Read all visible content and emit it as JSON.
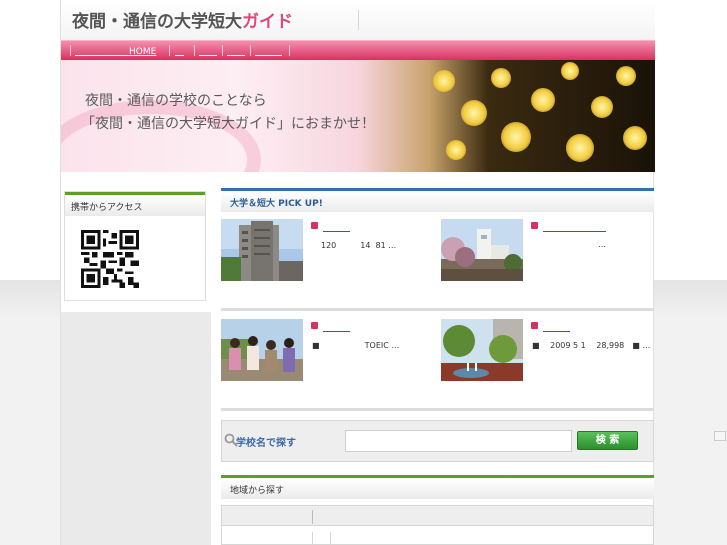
{
  "header": {
    "logo_main": "夜間・通信の大学短大",
    "logo_accent": "ガイド"
  },
  "nav": {
    "home": "　　　　　　HOME",
    "item2": "　",
    "item3": "　　",
    "item4": "　　",
    "item5": "　　　"
  },
  "hero": {
    "line1": "夜間・通信の学校のことなら",
    "line2": "「夜間・通信の大学短大ガイド」におまかせ！"
  },
  "sidebar": {
    "mobile_access_title": "携帯からアクセス"
  },
  "pickup": {
    "title": "大学＆短大 PICK UP!",
    "cards": [
      {
        "link": "　　　",
        "text": "120　　　14  81 …"
      },
      {
        "link": "　　　　　　　",
        "text": "…"
      },
      {
        "link": "　　　",
        "text": "■　　　　　  TOEIC …"
      },
      {
        "link": "　　　",
        "text": "■　 2009 5 1　 28,998　■ …"
      }
    ]
  },
  "search": {
    "label": "学校名で探す",
    "input_value": "",
    "button": "検 索"
  },
  "region": {
    "title": "地域から探す"
  },
  "colors": {
    "brand_pink": "#d8325f",
    "accent_green": "#5aa02c",
    "accent_blue": "#2f6fb2"
  }
}
